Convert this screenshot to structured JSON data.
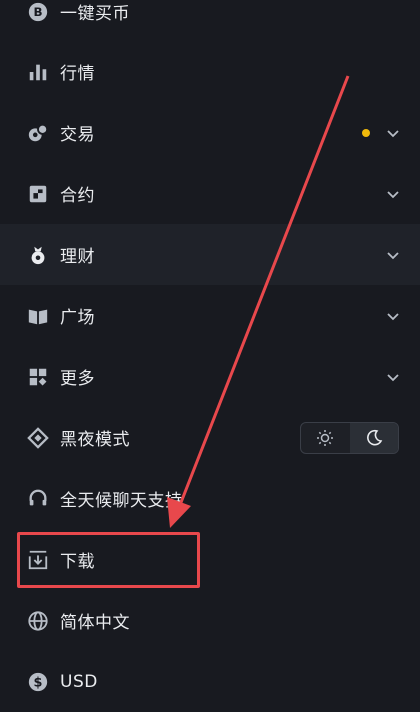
{
  "menu": {
    "items": [
      {
        "label": "一键买币",
        "icon": "bitcoin-icon"
      },
      {
        "label": "行情",
        "icon": "bar-chart-icon"
      },
      {
        "label": "交易",
        "icon": "trade-icon"
      },
      {
        "label": "合约",
        "icon": "futures-icon"
      },
      {
        "label": "理财",
        "icon": "earn-icon"
      },
      {
        "label": "广场",
        "icon": "book-icon"
      },
      {
        "label": "更多",
        "icon": "grid-icon"
      },
      {
        "label": "黑夜模式",
        "icon": "diamond-icon"
      },
      {
        "label": "全天候聊天支持",
        "icon": "headset-icon"
      },
      {
        "label": "下载",
        "icon": "download-icon"
      },
      {
        "label": "简体中文",
        "icon": "globe-icon"
      },
      {
        "label": "USD",
        "icon": "dollar-icon"
      }
    ]
  },
  "colors": {
    "background": "#181a20",
    "active_row": "#1f2229",
    "accent_dot": "#f0b90b",
    "annotation": "#e8484c"
  },
  "theme_toggle": {
    "options": [
      "sun-icon",
      "moon-icon"
    ],
    "selected": "moon-icon"
  }
}
